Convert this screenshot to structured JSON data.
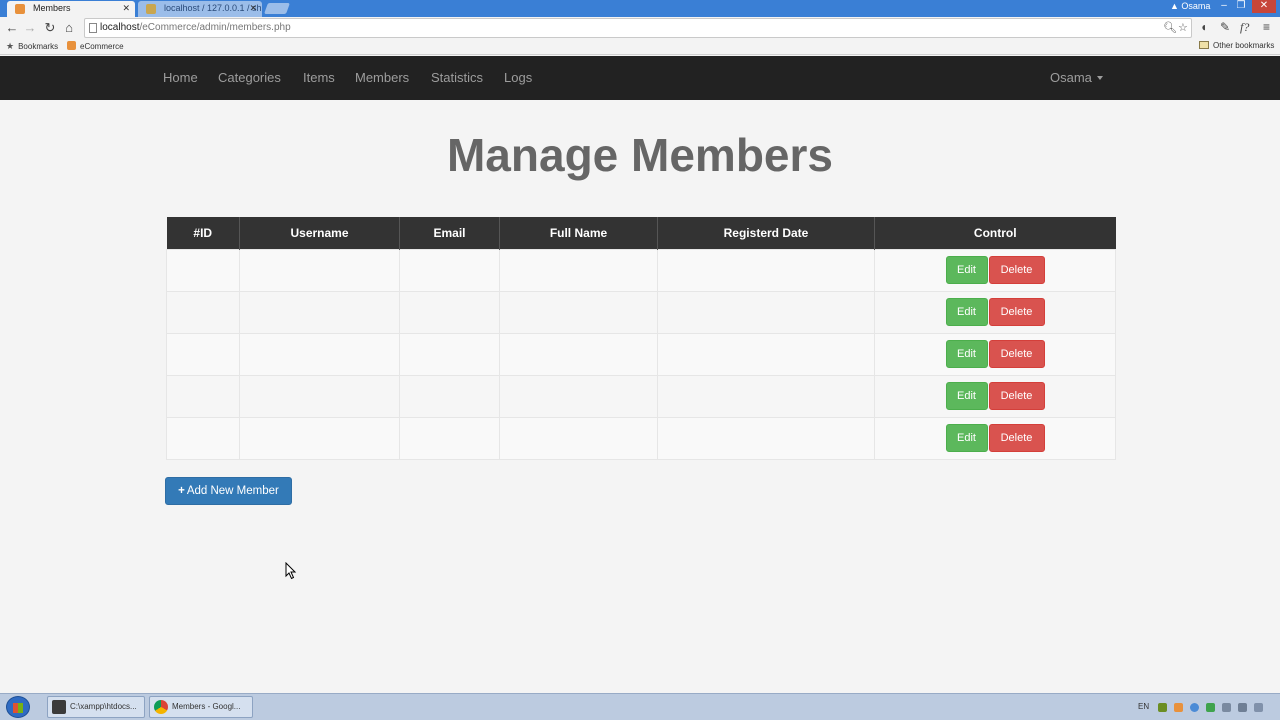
{
  "browser": {
    "tabs": [
      {
        "title": "Members",
        "active": true
      },
      {
        "title": "localhost / 127.0.0.1 / sho",
        "active": false
      }
    ],
    "window_user": "Osama",
    "url_host": "localhost",
    "url_path": "/eCommerce/admin/members.php",
    "bookmarks_label": "Bookmarks",
    "bookmark_ecommerce": "eCommerce",
    "other_bookmarks": "Other bookmarks"
  },
  "navbar": {
    "links": [
      "Home",
      "Categories",
      "Items",
      "Members",
      "Statistics",
      "Logs"
    ],
    "user": "Osama"
  },
  "page": {
    "title": "Manage Members"
  },
  "table": {
    "headers": [
      "#ID",
      "Username",
      "Email",
      "Full Name",
      "Registerd Date",
      "Control"
    ],
    "rows": [
      {
        "id": "",
        "username": "",
        "email": "",
        "full_name": "",
        "date": ""
      },
      {
        "id": "",
        "username": "",
        "email": "",
        "full_name": "",
        "date": ""
      },
      {
        "id": "",
        "username": "",
        "email": "",
        "full_name": "",
        "date": ""
      },
      {
        "id": "",
        "username": "",
        "email": "",
        "full_name": "",
        "date": ""
      },
      {
        "id": "",
        "username": "",
        "email": "",
        "full_name": "",
        "date": ""
      }
    ],
    "edit_label": "Edit",
    "delete_label": "Delete"
  },
  "add_button": {
    "icon": "+",
    "label": "Add New Member"
  },
  "taskbar": {
    "items": [
      "C:\\xampp\\htdocs...",
      "Members - Googl..."
    ],
    "language": "EN"
  },
  "colors": {
    "navbar": "#222222",
    "edit": "#5cb85c",
    "delete": "#d9534f",
    "primary": "#337ab7"
  }
}
